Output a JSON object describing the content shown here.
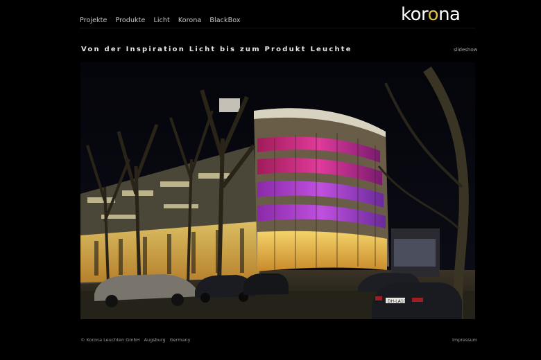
{
  "nav": {
    "items": [
      {
        "label": "Projekte"
      },
      {
        "label": "Produkte"
      },
      {
        "label": "Licht"
      },
      {
        "label": "Korona"
      },
      {
        "label": "BlackBox"
      }
    ]
  },
  "logo": {
    "part1": "kor",
    "part2": "o",
    "part3": "na"
  },
  "tagline": "Von der Inspiration Licht bis zum Produkt Leuchte",
  "slideshow_label": "slideshow",
  "photo": {
    "license_plate": "DH-LA10"
  },
  "footer": {
    "company": "© Korona Leuchten GmbH",
    "city": "Augsburg",
    "country": "Germany",
    "impressum": "Impressum"
  },
  "colors": {
    "background": "#000000",
    "logo_accent": "#e2c24f"
  }
}
